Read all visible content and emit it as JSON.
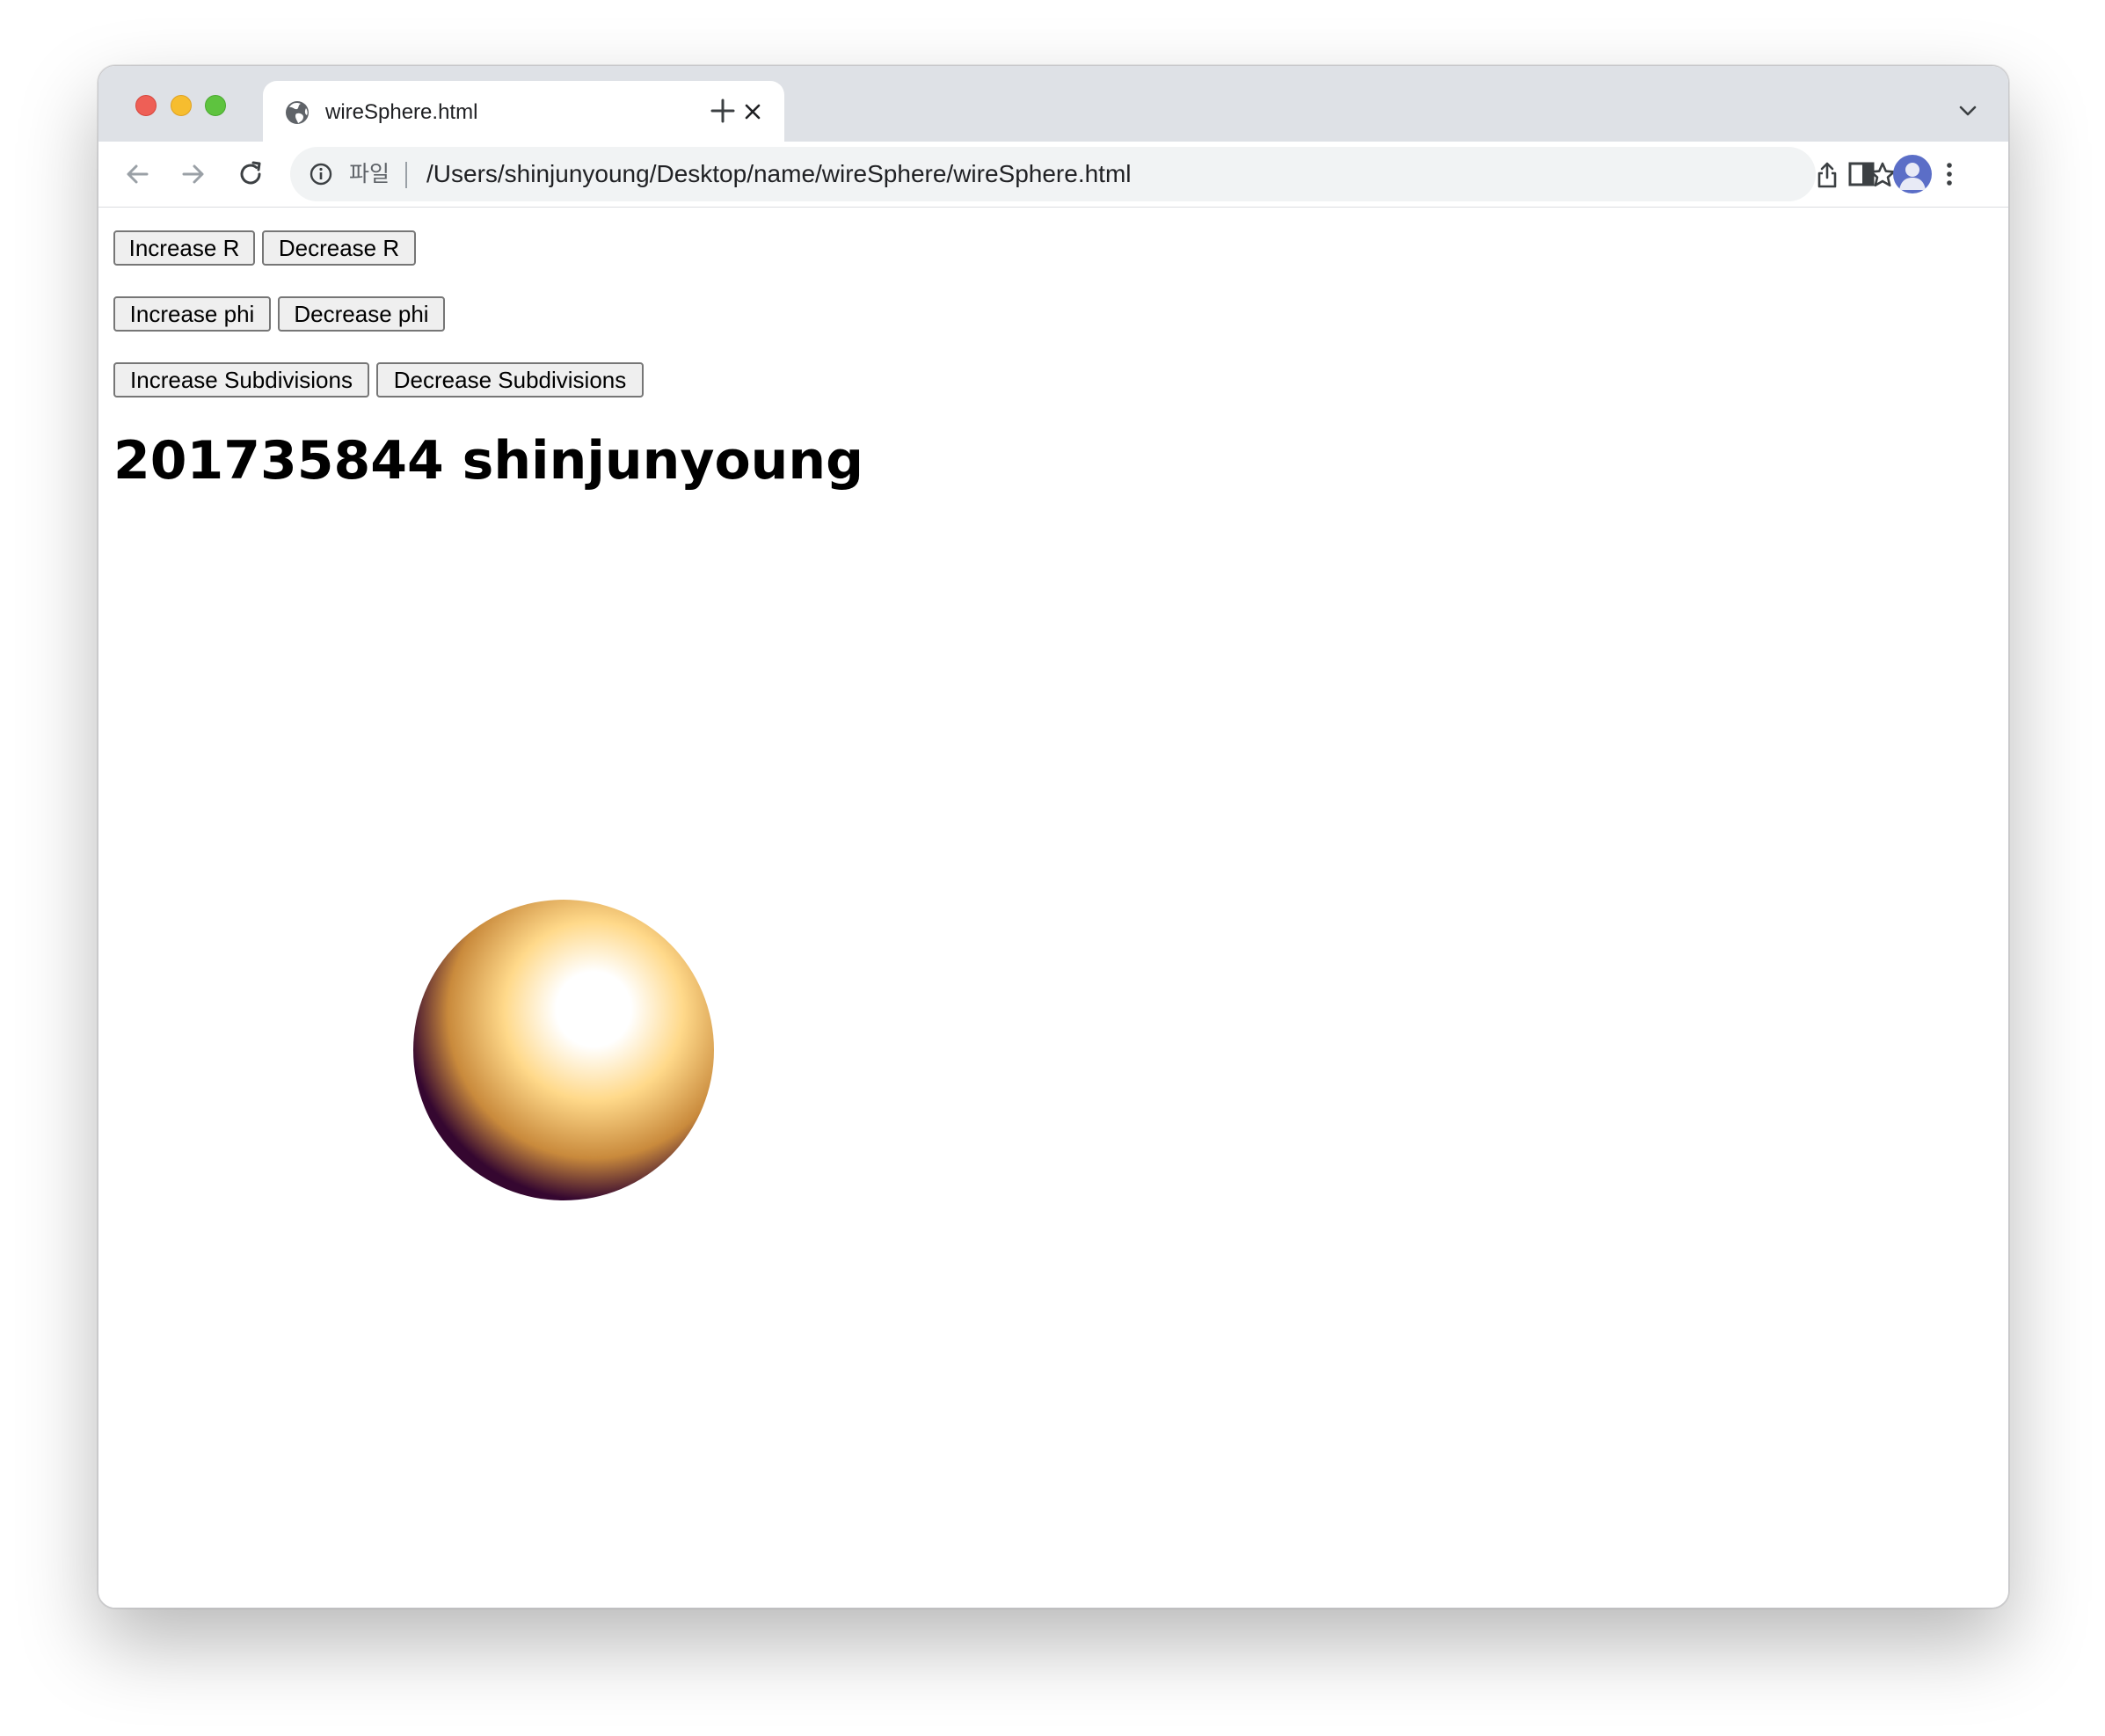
{
  "browser": {
    "tab_title": "wireSphere.html",
    "omnibox": {
      "scheme_label": "파일",
      "url": "/Users/shinjunyoung/Desktop/name/wireSphere/wireSphere.html"
    },
    "icons": [
      "globe-icon",
      "close-icon",
      "plus-icon",
      "chevron-down-icon",
      "back-arrow-icon",
      "forward-arrow-icon",
      "reload-icon",
      "info-icon",
      "share-icon",
      "star-icon",
      "side-panel-icon",
      "profile-avatar-icon",
      "more-vert-icon"
    ]
  },
  "page": {
    "buttons": {
      "increase_r": "Increase R",
      "decrease_r": "Decrease R",
      "increase_phi": "Increase phi",
      "decrease_phi": "Decrease phi",
      "increase_subdivisions": "Increase Subdivisions",
      "decrease_subdivisions": "Decrease Subdivisions"
    },
    "heading": "201735844 shinjunyoung",
    "sphere_colors": {
      "highlight": "#ffffff",
      "mid": "#ffd98a",
      "edge": "#c98a3c",
      "shadow": "#350730"
    }
  }
}
